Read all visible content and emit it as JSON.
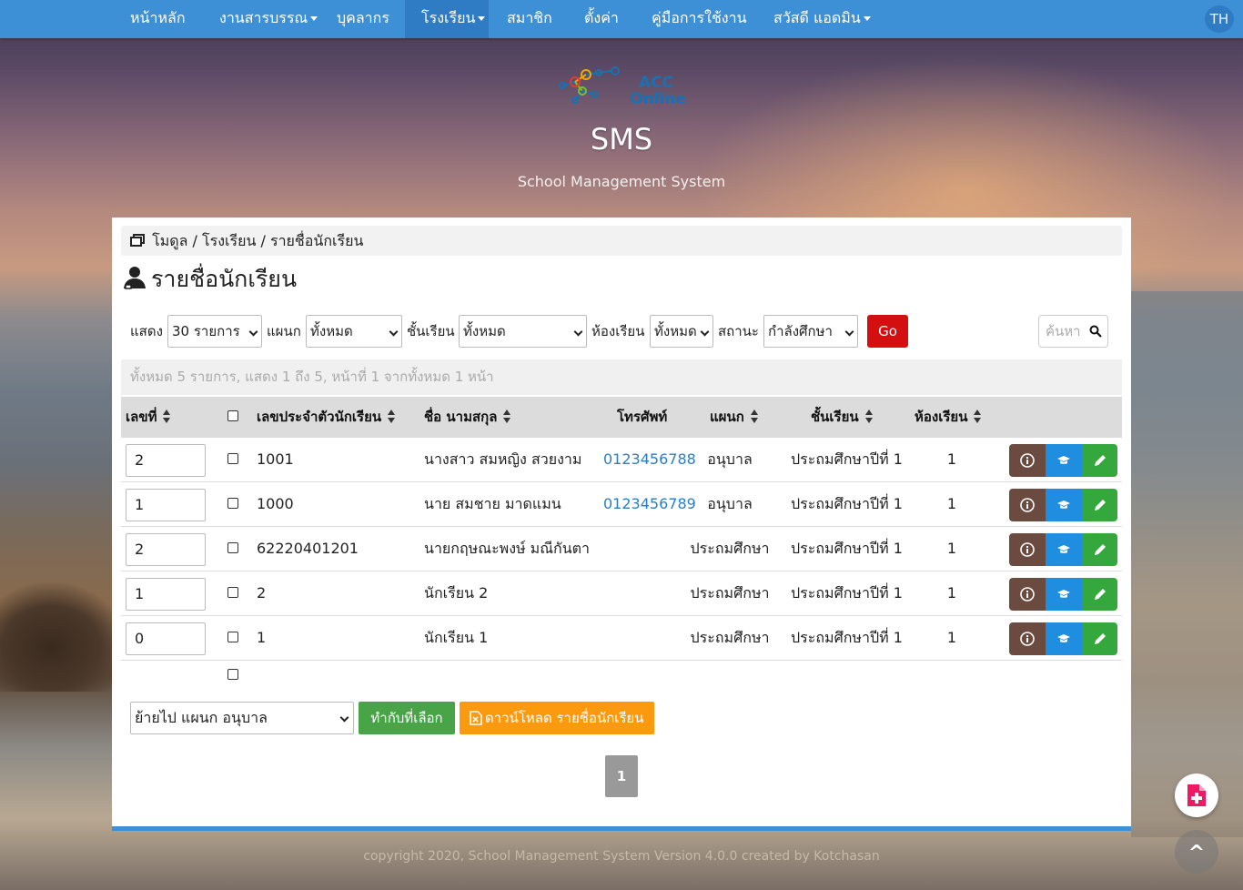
{
  "nav": {
    "items": [
      {
        "label": "หน้าหลัก",
        "dropdown": false
      },
      {
        "label": "งานสารบรรณ",
        "dropdown": true
      },
      {
        "label": "บุคลากร",
        "dropdown": false
      },
      {
        "label": "โรงเรียน",
        "dropdown": true,
        "active": true
      },
      {
        "label": "สมาชิก",
        "dropdown": false
      },
      {
        "label": "ตั้งค่า",
        "dropdown": false
      },
      {
        "label": "คู่มือการใช้งาน",
        "dropdown": false
      },
      {
        "label": "สวัสดี แอดมิน",
        "dropdown": true
      }
    ],
    "language": "TH"
  },
  "header": {
    "logo_text_1": "ACC",
    "logo_text_2": "Online",
    "title": "SMS",
    "subtitle": "School Management System"
  },
  "breadcrumb": {
    "module": "โมดูล",
    "school": "โรงเรียน",
    "current": "รายชื่อนักเรียน",
    "sep": "/"
  },
  "page_title": "รายชื่อนักเรียน",
  "filters": {
    "show_label": "แสดง",
    "show_value": "30 รายการ",
    "department_label": "แผนก",
    "department_value": "ทั้งหมด",
    "level_label": "ชั้นเรียน",
    "level_value": "ทั้งหมด",
    "room_label": "ห้องเรียน",
    "room_value": "ทั้งหมด",
    "status_label": "สถานะ",
    "status_value": "กำลังศึกษา",
    "go_label": "Go",
    "search_placeholder": "ค้นหา"
  },
  "summary": "ทั้งหมด 5 รายการ, แสดง 1 ถึง 5, หน้าที่ 1 จากทั้งหมด 1 หน้า",
  "table": {
    "headers": {
      "no": "เลขที่",
      "student_id": "เลขประจำตัวนักเรียน",
      "name": "ชื่อ นามสกุล",
      "phone": "โทรศัพท์",
      "department": "แผนก",
      "level": "ชั้นเรียน",
      "room": "ห้องเรียน"
    },
    "rows": [
      {
        "no": "2",
        "student_id": "1001",
        "name": "นางสาว สมหญิง สวยงาม",
        "phone": "0123456788",
        "department": "อนุบาล",
        "level": "ประถมศึกษาปีที่ 1",
        "room": "1"
      },
      {
        "no": "1",
        "student_id": "1000",
        "name": "นาย สมชาย มาดแมน",
        "phone": "0123456789",
        "department": "อนุบาล",
        "level": "ประถมศึกษาปีที่ 1",
        "room": "1"
      },
      {
        "no": "2",
        "student_id": "62220401201",
        "name": "นายกฤษณะพงษ์ มณีกันตา",
        "phone": "",
        "department": "ประถมศึกษา",
        "level": "ประถมศึกษาปีที่ 1",
        "room": "1"
      },
      {
        "no": "1",
        "student_id": "2",
        "name": "นักเรียน 2",
        "phone": "",
        "department": "ประถมศึกษา",
        "level": "ประถมศึกษาปีที่ 1",
        "room": "1"
      },
      {
        "no": "0",
        "student_id": "1",
        "name": "นักเรียน 1",
        "phone": "",
        "department": "ประถมศึกษา",
        "level": "ประถมศึกษาปีที่ 1",
        "room": "1"
      }
    ]
  },
  "bulk": {
    "move_value": "ย้ายไป แผนก อนุบาล",
    "apply_label": "ทำกับที่เลือก",
    "download_label": "ดาวน์โหลด รายชื่อนักเรียน"
  },
  "pagination": {
    "current": "1"
  },
  "footer": "copyright 2020, School Management System Version 4.0.0 created by Kotchasan",
  "colors": {
    "nav": "#3d8fd6",
    "go": "#d40f0f",
    "apply": "#48a447",
    "download": "#fb9a0e",
    "info": "#6b4b40",
    "grad": "#1f8de0",
    "edit": "#34a83c",
    "link": "#2a7ec3"
  }
}
